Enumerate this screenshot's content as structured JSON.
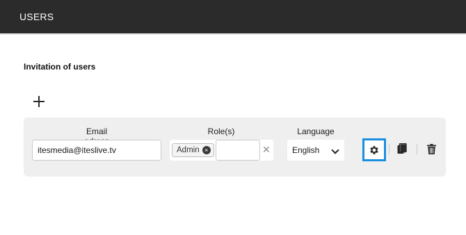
{
  "header": {
    "title": "USERS"
  },
  "section": {
    "title": "Invitation of users"
  },
  "icons": {
    "add": "plus-icon",
    "settings": "gear-icon",
    "copy": "copy-icon",
    "delete": "trash-icon",
    "remove_role": "x-circle-icon",
    "clear": "close-icon",
    "dropdown": "chevron-down-icon"
  },
  "form": {
    "columns": {
      "email": "Email adress",
      "roles": "Role(s)",
      "language": "Language"
    },
    "email_value": "itesmedia@iteslive.tv",
    "roles": [
      {
        "label": "Admin"
      }
    ],
    "role_input_value": "",
    "clear_glyph": "✕",
    "chip_remove_glyph": "×",
    "language_value": "English"
  },
  "colors": {
    "topbar": "#2b2b2b",
    "card": "#efefef",
    "highlight": "#1a8fe0"
  }
}
